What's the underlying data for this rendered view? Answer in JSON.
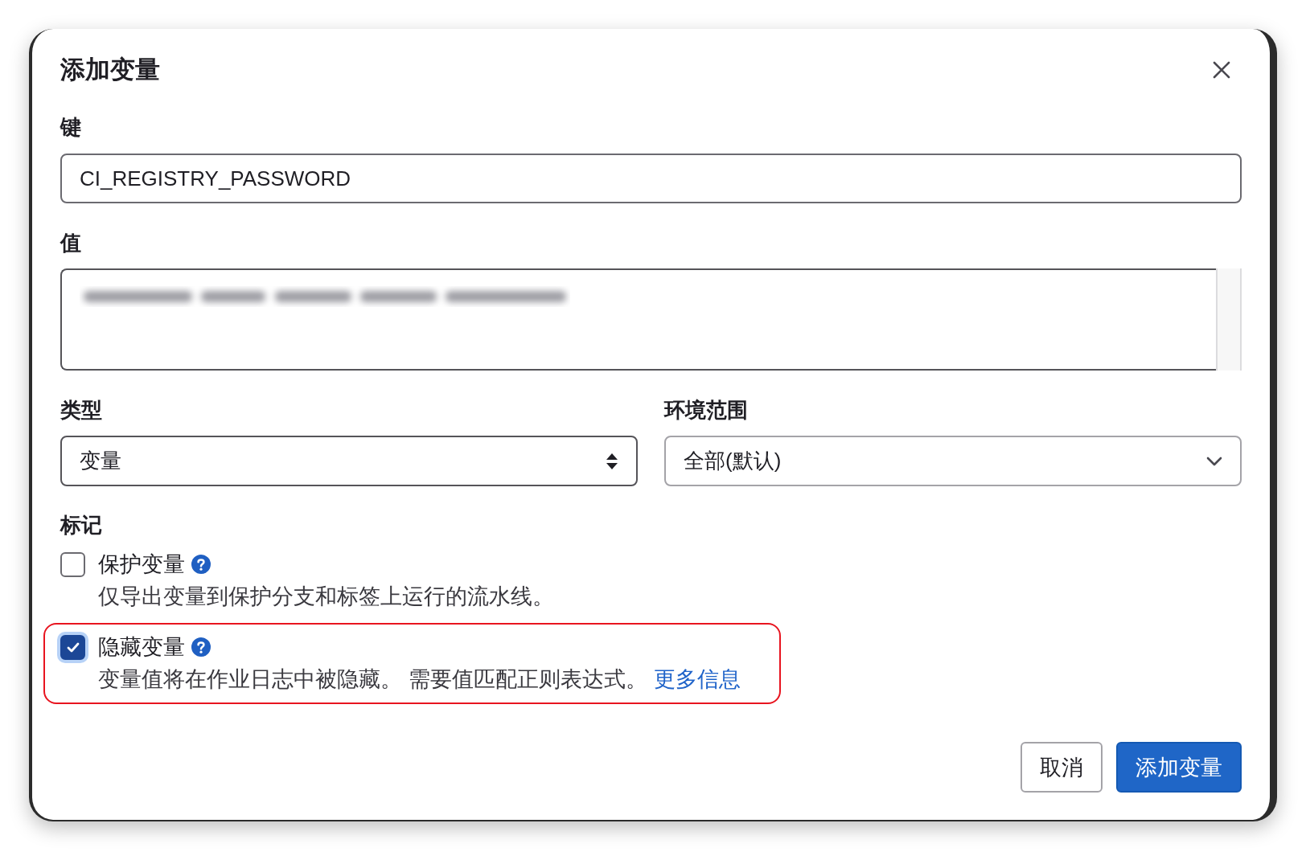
{
  "dialog": {
    "title": "添加变量"
  },
  "key_field": {
    "label": "键",
    "value": "CI_REGISTRY_PASSWORD"
  },
  "value_field": {
    "label": "值",
    "redacted": true
  },
  "type_select": {
    "label": "类型",
    "value": "变量",
    "kind": "stepper"
  },
  "environment_select": {
    "label": "环境范围",
    "value": "全部(默认)",
    "kind": "dropdown"
  },
  "flags": {
    "label": "标记",
    "options": [
      {
        "label": "保护变量",
        "checked": false,
        "highlighted": false,
        "description": "仅导出变量到保护分支和标签上运行的流水线。"
      },
      {
        "label": "隐藏变量",
        "checked": true,
        "highlighted": true,
        "description": "变量值将在作业日志中被隐藏。 需要值匹配正则表达式。",
        "link": "更多信息"
      }
    ]
  },
  "buttons": [
    {
      "label": "取消",
      "kind": "secondary"
    },
    {
      "label": "添加变量",
      "kind": "primary"
    }
  ]
}
